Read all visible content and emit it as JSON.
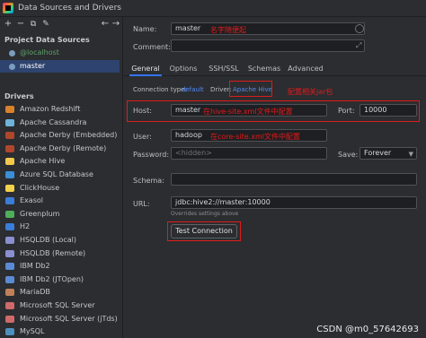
{
  "window": {
    "title": "Data Sources and Drivers"
  },
  "toolbar": {
    "add": "+",
    "remove": "−",
    "copy": "⧉",
    "edit": "✎",
    "back": "←",
    "forward": "→"
  },
  "left": {
    "project_header": "Project Data Sources",
    "sources": [
      "@localhost",
      "master"
    ],
    "drivers_header": "Drivers",
    "drivers": [
      "Amazon Redshift",
      "Apache Cassandra",
      "Apache Derby (Embedded)",
      "Apache Derby (Remote)",
      "Apache Hive",
      "Azure SQL Database",
      "ClickHouse",
      "Exasol",
      "Greenplum",
      "H2",
      "HSQLDB (Local)",
      "HSQLDB (Remote)",
      "IBM Db2",
      "IBM Db2 (JTOpen)",
      "MariaDB",
      "Microsoft SQL Server",
      "Microsoft SQL Server (jTds)",
      "MySQL"
    ]
  },
  "form": {
    "name_label": "Name:",
    "name_value": "master",
    "name_note": "名字随便起",
    "comment_label": "Comment:",
    "tabs": [
      "General",
      "Options",
      "SSH/SSL",
      "Schemas",
      "Advanced"
    ],
    "conn_type_label": "Connection type:",
    "conn_type_value": "default",
    "driver_label": "Driver:",
    "driver_value": "Apache Hive",
    "driver_note": "配置相关jar包",
    "host_label": "Host:",
    "host_value": "master",
    "host_note": "在hive-site.xml文件中配置",
    "port_label": "Port:",
    "port_value": "10000",
    "user_label": "User:",
    "user_value": "hadoop",
    "user_note": "在core-site.xml文件中配置",
    "password_label": "Password:",
    "password_value": "<hidden>",
    "save_label": "Save:",
    "save_value": "Forever",
    "schema_label": "Schema:",
    "url_label": "URL:",
    "url_value": "jdbc:hive2://master:10000",
    "url_hint": "Overrides settings above",
    "test_button": "Test Connection"
  },
  "watermark": "CSDN @m0_57642693",
  "colors": {
    "accent": "#3574f0",
    "annotation": "#e01b1b",
    "selection": "#2e436e"
  }
}
